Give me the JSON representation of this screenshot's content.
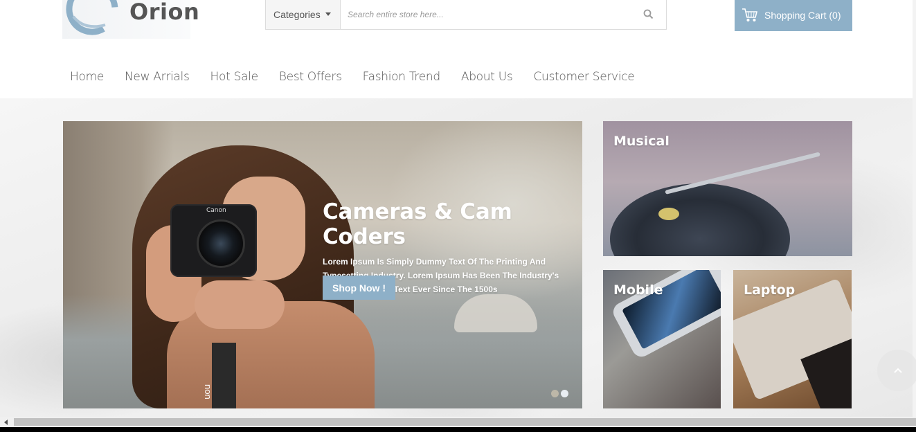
{
  "brand": {
    "name": "Orion",
    "accent": "#8eb0c8"
  },
  "search": {
    "category_label": "Categories",
    "placeholder": "Search entire store here...",
    "icon": "search-icon"
  },
  "cart": {
    "label": "Shopping Cart (0)",
    "icon": "cart-icon"
  },
  "nav": {
    "items": [
      {
        "label": "Home"
      },
      {
        "label": "New Arrials"
      },
      {
        "label": "Hot Sale"
      },
      {
        "label": "Best Offers"
      },
      {
        "label": "Fashion Trend"
      },
      {
        "label": "About Us"
      },
      {
        "label": "Customer Service"
      }
    ]
  },
  "slider": {
    "camera_brand": "Canon",
    "strap_text": "non",
    "title": "Cameras & Cam Coders",
    "description": "Lorem Ipsum Is Simply Dummy Text Of The Printing And Typesetting Industry. Lorem Ipsum Has Been The Industry's Standard Dummy Text Ever Since The 1500s",
    "button_label": "Shop Now !",
    "dots": [
      {
        "color": "#bdb7a8"
      },
      {
        "color": "#e9eef3"
      }
    ]
  },
  "categories": [
    {
      "label": "Musical"
    },
    {
      "label": "Mobile"
    },
    {
      "label": "Laptop"
    }
  ],
  "back_to_top_icon": "chevron-up-icon"
}
